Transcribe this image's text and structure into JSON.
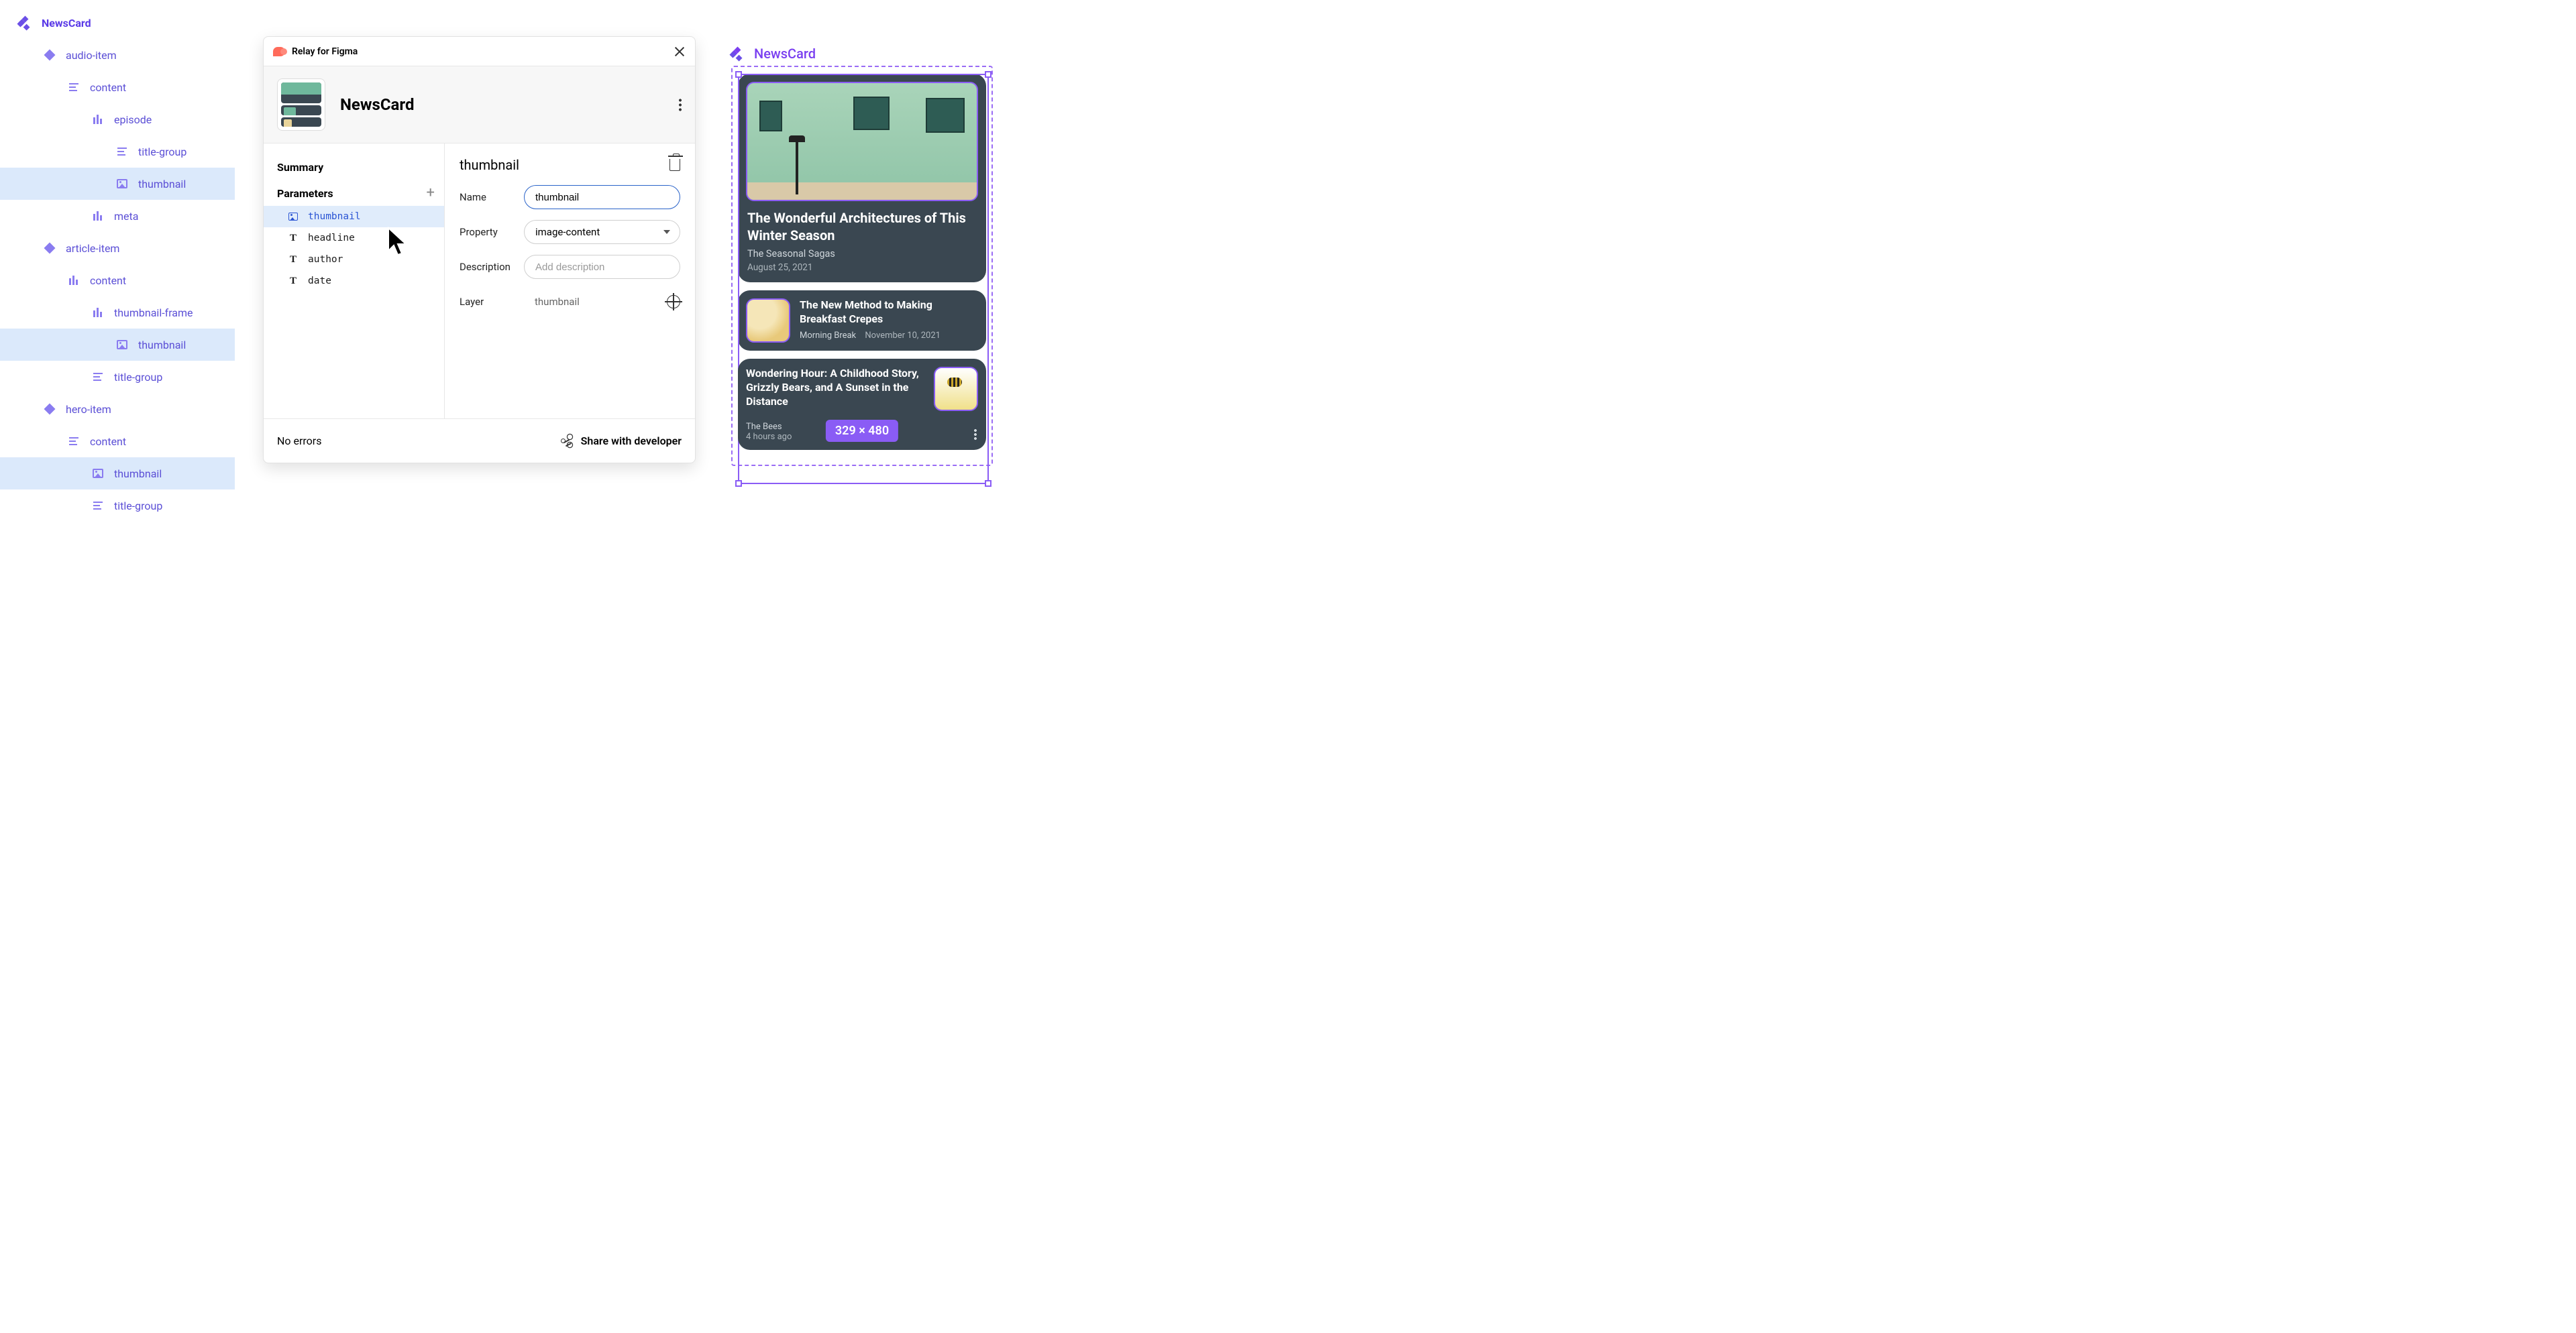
{
  "tree": {
    "root": "NewsCard",
    "items": [
      {
        "label": "audio-item",
        "icon": "diamond",
        "indent": 1
      },
      {
        "label": "content",
        "icon": "lines",
        "indent": 2
      },
      {
        "label": "episode",
        "icon": "bars",
        "indent": 3
      },
      {
        "label": "title-group",
        "icon": "lines",
        "indent": 4
      },
      {
        "label": "thumbnail",
        "icon": "image",
        "indent": 4,
        "selected": true
      },
      {
        "label": "meta",
        "icon": "bars",
        "indent": 3
      },
      {
        "label": "article-item",
        "icon": "diamond",
        "indent": 1
      },
      {
        "label": "content",
        "icon": "bars",
        "indent": 2
      },
      {
        "label": "thumbnail-frame",
        "icon": "bars",
        "indent": 3
      },
      {
        "label": "thumbnail",
        "icon": "image",
        "indent": 4,
        "selected": true
      },
      {
        "label": "title-group",
        "icon": "lines",
        "indent": 3
      },
      {
        "label": "hero-item",
        "icon": "diamond",
        "indent": 1
      },
      {
        "label": "content",
        "icon": "lines",
        "indent": 2
      },
      {
        "label": "thumbnail",
        "icon": "image",
        "indent": 3,
        "selected": true
      },
      {
        "label": "title-group",
        "icon": "lines",
        "indent": 3
      }
    ]
  },
  "panel": {
    "plugin_name": "Relay for Figma",
    "component_name": "NewsCard",
    "summary_label": "Summary",
    "parameters_label": "Parameters",
    "params": [
      {
        "name": "thumbnail",
        "icon": "image",
        "active": true
      },
      {
        "name": "headline",
        "icon": "text"
      },
      {
        "name": "author",
        "icon": "text"
      },
      {
        "name": "date",
        "icon": "text"
      }
    ],
    "detail": {
      "title": "thumbnail",
      "name_label": "Name",
      "name_value": "thumbnail",
      "property_label": "Property",
      "property_value": "image-content",
      "description_label": "Description",
      "description_placeholder": "Add description",
      "layer_label": "Layer",
      "layer_value": "thumbnail"
    },
    "footer": {
      "errors": "No errors",
      "share": "Share with developer"
    }
  },
  "canvas": {
    "label": "NewsCard",
    "dim": "329 × 480",
    "hero": {
      "headline": "The Wonderful Architectures of This Winter Season",
      "author": "The Seasonal Sagas",
      "date": "August 25, 2021"
    },
    "article": {
      "headline": "The New Method to Making Breakfast Crepes",
      "author": "Morning Break",
      "date": "November 10, 2021"
    },
    "audio": {
      "headline": "Wondering Hour: A Childhood Story, Grizzly Bears, and A Sunset in the Distance",
      "author": "The Bees",
      "date": "4 hours ago"
    }
  }
}
